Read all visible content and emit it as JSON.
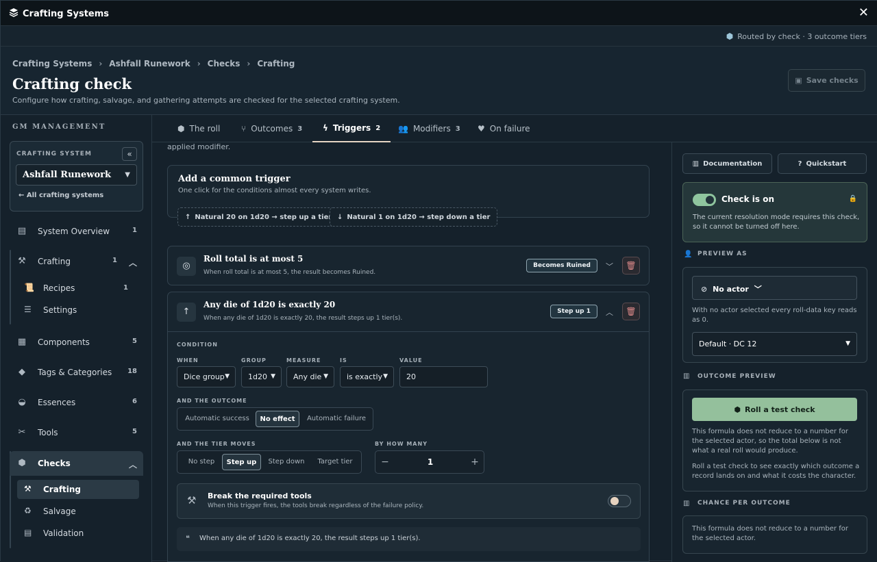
{
  "app": {
    "title": "Crafting Systems",
    "close": "✕"
  },
  "routed": {
    "text": "Routed by check · 3 outcome tiers"
  },
  "breadcrumb": [
    "Crafting Systems",
    "Ashfall Runework",
    "Checks",
    "Crafting"
  ],
  "page": {
    "title": "Crafting check",
    "subtitle": "Configure how crafting, salvage, and gathering attempts are checked for the selected crafting system.",
    "save_label": "Save checks"
  },
  "sidebar": {
    "heading": "GM MANAGEMENT",
    "system_label": "CRAFTING SYSTEM",
    "system_value": "Ashfall Runework",
    "all_systems": "All crafting systems",
    "items": [
      {
        "label": "System Overview",
        "count": "1"
      },
      {
        "label": "Crafting",
        "count": "1"
      },
      {
        "label": "Recipes",
        "count": "1"
      },
      {
        "label": "Settings",
        "count": ""
      },
      {
        "label": "Components",
        "count": "5"
      },
      {
        "label": "Tags & Categories",
        "count": "18"
      },
      {
        "label": "Essences",
        "count": "6"
      },
      {
        "label": "Tools",
        "count": "5"
      },
      {
        "label": "Checks",
        "count": ""
      },
      {
        "label": "Crafting",
        "count": ""
      },
      {
        "label": "Salvage",
        "count": ""
      },
      {
        "label": "Validation",
        "count": ""
      }
    ]
  },
  "tabs": [
    {
      "label": "The roll",
      "count": ""
    },
    {
      "label": "Outcomes",
      "count": "3"
    },
    {
      "label": "Triggers",
      "count": "2"
    },
    {
      "label": "Modifiers",
      "count": "3"
    },
    {
      "label": "On failure",
      "count": ""
    }
  ],
  "main": {
    "fragment": "applied modifier.",
    "common": {
      "title": "Add a common trigger",
      "sub": "One click for the conditions almost every system writes.",
      "chip1": "Natural 20 on 1d20 → step up a tier",
      "chip2": "Natural 1 on 1d20 → step down a tier"
    },
    "trigger1": {
      "title": "Roll total is at most 5",
      "desc": "When roll total is at most 5, the result becomes Ruined.",
      "badge": "Becomes Ruined"
    },
    "trigger2": {
      "title": "Any die of 1d20 is exactly 20",
      "desc": "When any die of 1d20 is exactly 20, the result steps up 1 tier(s).",
      "badge": "Step up 1",
      "condition_label": "CONDITION",
      "when_label": "WHEN",
      "when": "Dice group",
      "group_label": "GROUP",
      "group": "1d20",
      "measure_label": "MEASURE",
      "measure": "Any die",
      "is_label": "IS",
      "is": "is exactly",
      "value_label": "VALUE",
      "value": "20",
      "outcome_label": "AND THE OUTCOME",
      "outcome_opts": [
        "Automatic success",
        "No effect",
        "Automatic failure"
      ],
      "tier_label": "AND THE TIER MOVES",
      "tier_opts": [
        "No step",
        "Step up",
        "Step down",
        "Target tier"
      ],
      "howmany_label": "BY HOW MANY",
      "howmany": "1",
      "break_title": "Break the required tools",
      "break_desc": "When this trigger fires, the tools break regardless of the failure policy.",
      "summary": "When any die of 1d20 is exactly 20, the result steps up 1 tier(s)."
    }
  },
  "right": {
    "doc": "Documentation",
    "quick": "Quickstart",
    "check_on": "Check is on",
    "check_desc": "The current resolution mode requires this check, so it cannot be turned off here.",
    "preview_as": "PREVIEW AS",
    "actor": "No actor",
    "actor_note": "With no actor selected every roll-data key reads as 0.",
    "dc": "Default · DC 12",
    "outcome_preview": "OUTCOME PREVIEW",
    "roll_btn": "Roll a test check",
    "note1": "This formula does not reduce to a number for the selected actor, so the total below is not what a real roll would produce.",
    "note2": "Roll a test check to see exactly which outcome a record lands on and what it costs the character.",
    "chance": "CHANCE PER OUTCOME",
    "chance_note": "This formula does not reduce to a number for the selected actor."
  }
}
